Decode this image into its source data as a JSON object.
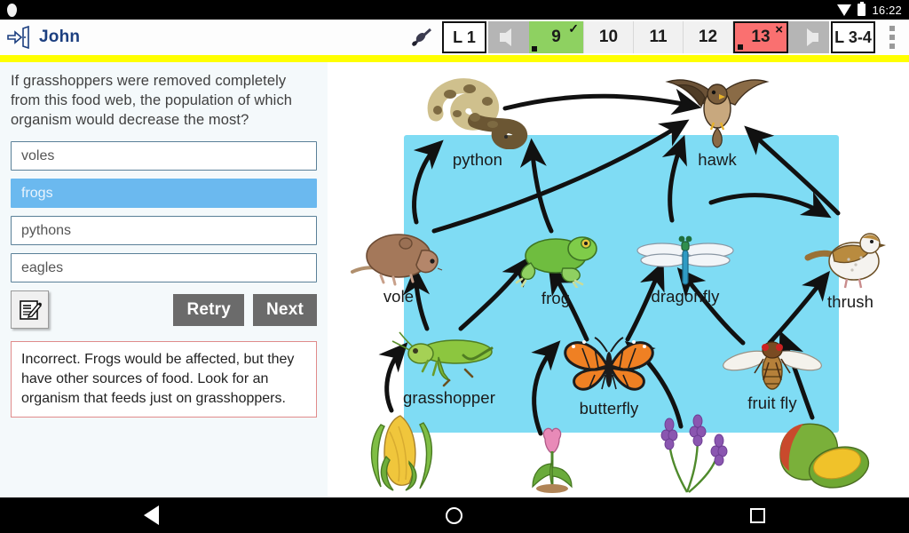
{
  "status_bar": {
    "time": "16:22",
    "icons": [
      "notification-dot-icon",
      "wifi-icon",
      "battery-icon"
    ]
  },
  "header": {
    "exit_icon": "exit-door-icon",
    "user_name": "John",
    "stylus_icon": "stylus-icon",
    "overflow_icon": "kebab-menu-icon",
    "nav_cells": [
      {
        "label": "L 1",
        "type": "lesson",
        "mark": ""
      },
      {
        "label": "",
        "type": "arrow-left",
        "mark": ""
      },
      {
        "label": "9",
        "type": "correct",
        "mark": "✓"
      },
      {
        "label": "10",
        "type": "plain",
        "mark": ""
      },
      {
        "label": "11",
        "type": "plain",
        "mark": ""
      },
      {
        "label": "12",
        "type": "plain",
        "mark": ""
      },
      {
        "label": "13",
        "type": "wrong",
        "mark": "×"
      },
      {
        "label": "",
        "type": "arrow-right",
        "mark": ""
      },
      {
        "label": "L 3-4",
        "type": "lesson",
        "mark": ""
      }
    ]
  },
  "question": {
    "prompt": "If grasshoppers were removed completely from this food web, the population of which organism would decrease the most?",
    "options": [
      {
        "label": "voles",
        "selected": false
      },
      {
        "label": "frogs",
        "selected": true
      },
      {
        "label": "pythons",
        "selected": false
      },
      {
        "label": "eagles",
        "selected": false
      }
    ],
    "notepad_icon": "notepad-edit-icon",
    "retry_label": "Retry",
    "next_label": "Next",
    "feedback": "Incorrect. Frogs would be affected, but they have other sources of food. Look for an organism that feeds just on grasshoppers."
  },
  "diagram": {
    "title": "food-web",
    "highlight_color": "#7fdcf4",
    "nodes": [
      {
        "id": "python",
        "label": "python"
      },
      {
        "id": "hawk",
        "label": "hawk"
      },
      {
        "id": "vole",
        "label": "vole"
      },
      {
        "id": "frog",
        "label": "frog"
      },
      {
        "id": "dragonfly",
        "label": "dragonfly"
      },
      {
        "id": "thrush",
        "label": "thrush"
      },
      {
        "id": "grasshopper",
        "label": "grasshopper"
      },
      {
        "id": "butterfly",
        "label": "butterfly"
      },
      {
        "id": "fruitfly",
        "label": "fruit fly"
      },
      {
        "id": "corn",
        "label": "corn"
      },
      {
        "id": "tulip",
        "label": "tulip"
      },
      {
        "id": "lavender",
        "label": "lavender"
      },
      {
        "id": "mango",
        "label": "mango"
      }
    ],
    "edges": [
      {
        "from": "vole",
        "to": "python"
      },
      {
        "from": "python",
        "to": "hawk"
      },
      {
        "from": "vole",
        "to": "hawk"
      },
      {
        "from": "frog",
        "to": "python"
      },
      {
        "from": "dragonfly",
        "to": "hawk"
      },
      {
        "from": "thrush",
        "to": "hawk"
      },
      {
        "from": "grasshopper",
        "to": "vole"
      },
      {
        "from": "grasshopper",
        "to": "frog"
      },
      {
        "from": "butterfly",
        "to": "frog"
      },
      {
        "from": "butterfly",
        "to": "dragonfly"
      },
      {
        "from": "fruitfly",
        "to": "dragonfly"
      },
      {
        "from": "fruitfly",
        "to": "thrush"
      },
      {
        "from": "dragonfly",
        "to": "thrush"
      },
      {
        "from": "corn",
        "to": "grasshopper"
      },
      {
        "from": "tulip",
        "to": "butterfly"
      },
      {
        "from": "lavender",
        "to": "butterfly"
      },
      {
        "from": "mango",
        "to": "fruitfly"
      }
    ]
  },
  "navbar": {
    "back_icon": "back-triangle-icon",
    "home_icon": "home-circle-icon",
    "recents_icon": "recents-square-icon"
  }
}
